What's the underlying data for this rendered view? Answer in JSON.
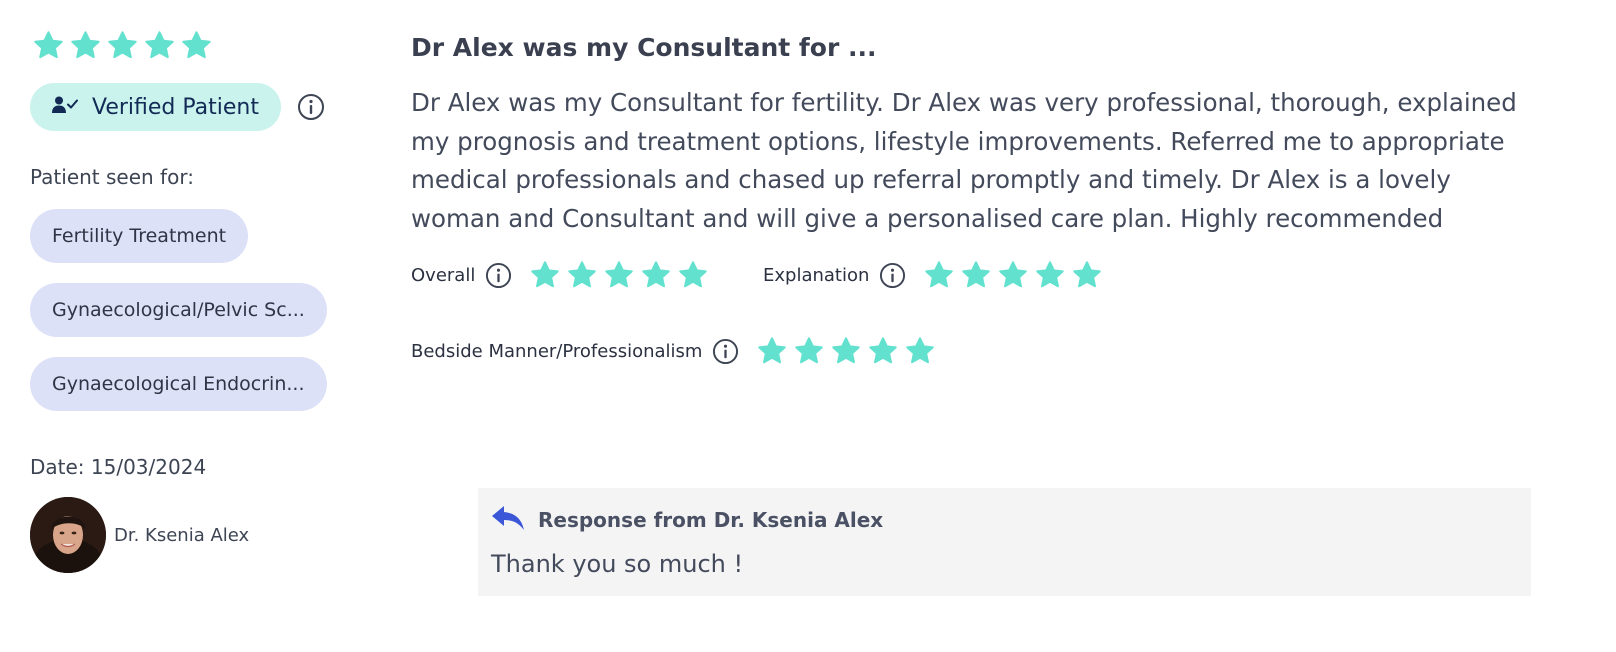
{
  "review": {
    "title": "Dr Alex was my Consultant for ...",
    "body": "Dr Alex was my Consultant for fertility. Dr Alex was very professional, thorough, explained my prognosis and treatment options, lifestyle improvements. Referred me to appropriate medical professionals and chased up referral promptly and timely. Dr Alex is a lovely woman and Consultant and will give a personalised care plan. Highly recommended",
    "overall_stars": 5,
    "verified_label": "Verified Patient",
    "seen_for_label": "Patient seen for:",
    "treatments": [
      "Fertility Treatment",
      "Gynaecological/Pelvic Sc...",
      "Gynaecological Endocrin..."
    ],
    "date": "Date: 15/03/2024",
    "doctor_name": "Dr. Ksenia Alex"
  },
  "ratings": [
    {
      "label": "Overall",
      "stars": 5
    },
    {
      "label": "Explanation",
      "stars": 5
    },
    {
      "label": "Bedside Manner/Professionalism",
      "stars": 5
    }
  ],
  "response": {
    "title": "Response from Dr. Ksenia Alex",
    "text": "Thank you so much !"
  },
  "colors": {
    "star": "#62e1cf",
    "verified_bg": "#c9f3ec",
    "tag_bg": "#dde1f7",
    "reply_icon": "#3b57d8",
    "response_bg": "#f4f4f5"
  },
  "icons": {
    "star": "star-icon",
    "verified": "user-check-icon",
    "info": "info-icon",
    "reply": "reply-arrow-icon"
  }
}
